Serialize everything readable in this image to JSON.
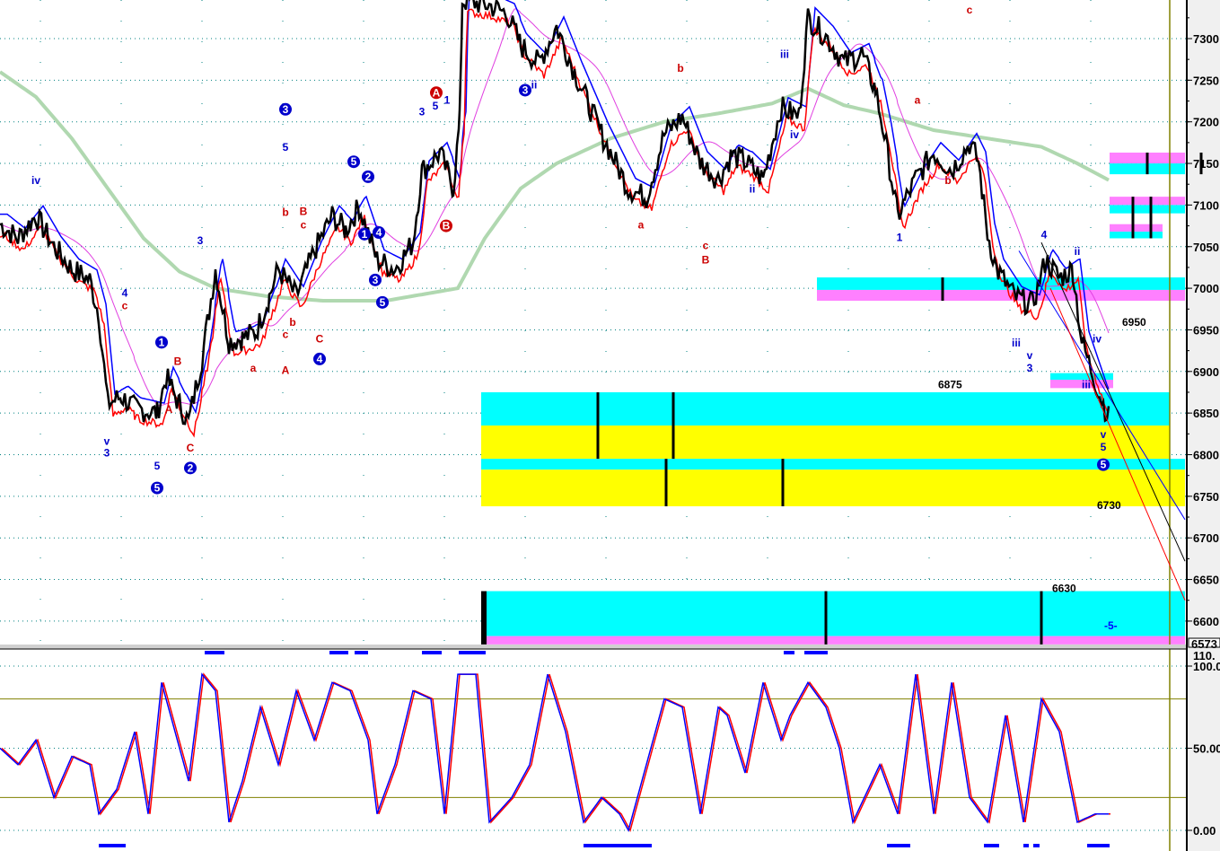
{
  "chart_data": {
    "type": "line",
    "title": "",
    "price_axis": {
      "ticks": [
        7300,
        7250,
        7200,
        7150,
        7100,
        7050,
        7000,
        6950,
        6900,
        6850,
        6800,
        6750,
        6700,
        6650,
        6600
      ],
      "range": [
        6573,
        7345
      ],
      "last_value_label": "6573"
    },
    "osc_axis": {
      "ticks": [
        "100.0",
        "50.00",
        "0.00"
      ],
      "tick_values": [
        100,
        50,
        0
      ],
      "top_label": "110.",
      "range": [
        -5,
        110
      ],
      "levels": [
        80,
        20
      ]
    },
    "x_range": [
      0,
      1300
    ],
    "price_series": [
      [
        0,
        7077
      ],
      [
        20,
        7060
      ],
      [
        40,
        7087
      ],
      [
        60,
        7050
      ],
      [
        80,
        7023
      ],
      [
        100,
        7010
      ],
      [
        110,
        6969
      ],
      [
        120,
        6861
      ],
      [
        135,
        6870
      ],
      [
        150,
        6856
      ],
      [
        175,
        6850
      ],
      [
        185,
        6893
      ],
      [
        200,
        6860
      ],
      [
        210,
        6839
      ],
      [
        225,
        6915
      ],
      [
        240,
        7023
      ],
      [
        255,
        6936
      ],
      [
        270,
        6940
      ],
      [
        285,
        6947
      ],
      [
        300,
        6990
      ],
      [
        310,
        7023
      ],
      [
        330,
        6990
      ],
      [
        350,
        7044
      ],
      [
        370,
        7087
      ],
      [
        385,
        7070
      ],
      [
        400,
        7098
      ],
      [
        420,
        7034
      ],
      [
        440,
        7023
      ],
      [
        460,
        7055
      ],
      [
        470,
        7141
      ],
      [
        490,
        7163
      ],
      [
        505,
        7120
      ],
      [
        512,
        7200
      ],
      [
        515,
        7346
      ],
      [
        545,
        7340
      ],
      [
        565,
        7330
      ],
      [
        580,
        7292
      ],
      [
        600,
        7270
      ],
      [
        620,
        7314
      ],
      [
        640,
        7260
      ],
      [
        670,
        7185
      ],
      [
        700,
        7120
      ],
      [
        720,
        7109
      ],
      [
        740,
        7185
      ],
      [
        760,
        7206
      ],
      [
        780,
        7152
      ],
      [
        800,
        7131
      ],
      [
        815,
        7160
      ],
      [
        830,
        7152
      ],
      [
        850,
        7131
      ],
      [
        870,
        7217
      ],
      [
        890,
        7206
      ],
      [
        900,
        7325
      ],
      [
        920,
        7303
      ],
      [
        940,
        7271
      ],
      [
        960,
        7282
      ],
      [
        975,
        7239
      ],
      [
        985,
        7185
      ],
      [
        1000,
        7087
      ],
      [
        1020,
        7131
      ],
      [
        1040,
        7163
      ],
      [
        1060,
        7142
      ],
      [
        1080,
        7174
      ],
      [
        1090,
        7152
      ],
      [
        1100,
        7066
      ],
      [
        1110,
        7023
      ],
      [
        1130,
        6990
      ],
      [
        1150,
        6980
      ],
      [
        1165,
        7034
      ],
      [
        1180,
        7012
      ],
      [
        1195,
        7023
      ],
      [
        1205,
        6936
      ],
      [
        1215,
        6904
      ],
      [
        1225,
        6872
      ],
      [
        1235,
        6845
      ]
    ],
    "moving_average": [
      [
        0,
        7260
      ],
      [
        40,
        7230
      ],
      [
        80,
        7180
      ],
      [
        120,
        7120
      ],
      [
        160,
        7060
      ],
      [
        200,
        7020
      ],
      [
        240,
        7000
      ],
      [
        300,
        6990
      ],
      [
        360,
        6985
      ],
      [
        430,
        6985
      ],
      [
        510,
        7000
      ],
      [
        540,
        7060
      ],
      [
        580,
        7120
      ],
      [
        620,
        7150
      ],
      [
        680,
        7180
      ],
      [
        740,
        7200
      ],
      [
        800,
        7210
      ],
      [
        860,
        7222
      ],
      [
        900,
        7240
      ],
      [
        940,
        7220
      ],
      [
        980,
        7210
      ],
      [
        1040,
        7190
      ],
      [
        1100,
        7180
      ],
      [
        1160,
        7170
      ],
      [
        1200,
        7150
      ],
      [
        1235,
        7130
      ]
    ],
    "oscillator": [
      [
        0,
        50
      ],
      [
        20,
        40
      ],
      [
        40,
        55
      ],
      [
        60,
        20
      ],
      [
        80,
        45
      ],
      [
        100,
        40
      ],
      [
        110,
        10
      ],
      [
        130,
        25
      ],
      [
        150,
        60
      ],
      [
        165,
        10
      ],
      [
        180,
        90
      ],
      [
        195,
        60
      ],
      [
        210,
        30
      ],
      [
        225,
        95
      ],
      [
        240,
        85
      ],
      [
        255,
        5
      ],
      [
        270,
        30
      ],
      [
        290,
        75
      ],
      [
        310,
        40
      ],
      [
        330,
        85
      ],
      [
        350,
        55
      ],
      [
        370,
        90
      ],
      [
        390,
        85
      ],
      [
        410,
        55
      ],
      [
        420,
        10
      ],
      [
        440,
        40
      ],
      [
        460,
        85
      ],
      [
        480,
        80
      ],
      [
        495,
        10
      ],
      [
        510,
        95
      ],
      [
        530,
        95
      ],
      [
        545,
        5
      ],
      [
        570,
        20
      ],
      [
        590,
        40
      ],
      [
        610,
        95
      ],
      [
        630,
        60
      ],
      [
        650,
        5
      ],
      [
        670,
        20
      ],
      [
        690,
        10
      ],
      [
        700,
        0
      ],
      [
        720,
        40
      ],
      [
        740,
        80
      ],
      [
        760,
        75
      ],
      [
        780,
        10
      ],
      [
        800,
        75
      ],
      [
        810,
        70
      ],
      [
        830,
        35
      ],
      [
        850,
        90
      ],
      [
        870,
        55
      ],
      [
        880,
        70
      ],
      [
        900,
        90
      ],
      [
        920,
        75
      ],
      [
        935,
        50
      ],
      [
        950,
        5
      ],
      [
        980,
        40
      ],
      [
        1000,
        10
      ],
      [
        1020,
        95
      ],
      [
        1040,
        10
      ],
      [
        1060,
        90
      ],
      [
        1080,
        20
      ],
      [
        1100,
        5
      ],
      [
        1120,
        70
      ],
      [
        1140,
        5
      ],
      [
        1160,
        80
      ],
      [
        1180,
        60
      ],
      [
        1200,
        5
      ],
      [
        1220,
        10
      ],
      [
        1235,
        10
      ]
    ],
    "zones": [
      {
        "x0": 536,
        "x1": 1303,
        "p0": 6875,
        "p1": 6835,
        "color": "#00ffff"
      },
      {
        "x0": 536,
        "x1": 1303,
        "p0": 6835,
        "p1": 6795,
        "color": "#ffff00"
      },
      {
        "x0": 536,
        "x1": 1320,
        "p0": 6795,
        "p1": 6782,
        "color": "#00ffff"
      },
      {
        "x0": 536,
        "x1": 1320,
        "p0": 6782,
        "p1": 6738,
        "color": "#ffff00"
      },
      {
        "x0": 536,
        "x1": 1320,
        "p0": 6636,
        "p1": 6582,
        "color": "#00ffff"
      },
      {
        "x0": 536,
        "x1": 1320,
        "p0": 6582,
        "p1": 6572,
        "color": "#ff80ff"
      },
      {
        "x0": 910,
        "x1": 1320,
        "p0": 7013,
        "p1": 6998,
        "color": "#00ffff"
      },
      {
        "x0": 910,
        "x1": 1320,
        "p0": 6998,
        "p1": 6985,
        "color": "#ff80ff"
      },
      {
        "x0": 1236,
        "x1": 1320,
        "p0": 7163,
        "p1": 7150,
        "color": "#ff80ff"
      },
      {
        "x0": 1236,
        "x1": 1320,
        "p0": 7150,
        "p1": 7137,
        "color": "#00ffff"
      },
      {
        "x0": 1236,
        "x1": 1320,
        "p0": 7110,
        "p1": 7100,
        "color": "#ff80ff"
      },
      {
        "x0": 1236,
        "x1": 1320,
        "p0": 7100,
        "p1": 7090,
        "color": "#00ffff"
      },
      {
        "x0": 1236,
        "x1": 1295,
        "p0": 7077,
        "p1": 7068,
        "color": "#ff80ff"
      },
      {
        "x0": 1236,
        "x1": 1295,
        "p0": 7068,
        "p1": 7060,
        "color": "#00ffff"
      },
      {
        "x0": 1170,
        "x1": 1240,
        "p0": 6898,
        "p1": 6890,
        "color": "#00ffff"
      },
      {
        "x0": 1170,
        "x1": 1240,
        "p0": 6890,
        "p1": 6880,
        "color": "#ff80ff"
      }
    ],
    "price_labels": [
      {
        "text": "6950",
        "x": 1250,
        "p": 6955
      },
      {
        "text": "6875",
        "x": 1045,
        "p": 6880
      },
      {
        "text": "6730",
        "x": 1222,
        "p": 6735
      },
      {
        "text": "6630",
        "x": 1172,
        "p": 6635
      },
      {
        "text": "-5-",
        "x": 1230,
        "p": 6590,
        "color": "#0000ff"
      }
    ],
    "wave_labels": [
      {
        "t": "iv",
        "x": 40,
        "p": 7125,
        "c": "#0000cc"
      },
      {
        "t": "4",
        "x": 139,
        "p": 6990,
        "c": "#0000cc"
      },
      {
        "t": "c",
        "x": 139,
        "p": 6975,
        "c": "#cc0000"
      },
      {
        "t": "v",
        "x": 119,
        "p": 6812,
        "c": "#0000cc"
      },
      {
        "t": "3",
        "x": 119,
        "p": 6798,
        "c": "#0000cc"
      },
      {
        "t": "5",
        "x": 175,
        "p": 6782,
        "c": "#0000cc"
      },
      {
        "t": "5",
        "x": 175,
        "p": 6760,
        "c": "#0000cc",
        "circle": true
      },
      {
        "t": "1",
        "x": 180,
        "p": 6935,
        "c": "#0000cc",
        "circle": true
      },
      {
        "t": "B",
        "x": 198,
        "p": 6908,
        "c": "#cc0000"
      },
      {
        "t": "A",
        "x": 188,
        "p": 6850,
        "c": "#cc0000"
      },
      {
        "t": "C",
        "x": 212,
        "p": 6804,
        "c": "#cc0000"
      },
      {
        "t": "2",
        "x": 212,
        "p": 6784,
        "c": "#0000cc",
        "circle": true
      },
      {
        "t": "3",
        "x": 223,
        "p": 7053,
        "c": "#0000cc"
      },
      {
        "t": "a",
        "x": 282,
        "p": 6900,
        "c": "#cc0000"
      },
      {
        "t": "A",
        "x": 318,
        "p": 6897,
        "c": "#cc0000"
      },
      {
        "t": "c",
        "x": 318,
        "p": 6940,
        "c": "#cc0000"
      },
      {
        "t": "b",
        "x": 326,
        "p": 6955,
        "c": "#cc0000"
      },
      {
        "t": "C",
        "x": 356,
        "p": 6935,
        "c": "#cc0000"
      },
      {
        "t": "4",
        "x": 356,
        "p": 6915,
        "c": "#0000cc",
        "circle": true
      },
      {
        "t": "3",
        "x": 318,
        "p": 7215,
        "c": "#0000cc",
        "circle": true
      },
      {
        "t": "5",
        "x": 318,
        "p": 7165,
        "c": "#0000cc"
      },
      {
        "t": "b",
        "x": 318,
        "p": 7087,
        "c": "#cc0000"
      },
      {
        "t": "B",
        "x": 338,
        "p": 7088,
        "c": "#cc0000"
      },
      {
        "t": "c",
        "x": 338,
        "p": 7072,
        "c": "#cc0000"
      },
      {
        "t": "5",
        "x": 394,
        "p": 7152,
        "c": "#0000cc",
        "circle": true
      },
      {
        "t": "2",
        "x": 410,
        "p": 7134,
        "c": "#0000cc",
        "circle": true
      },
      {
        "t": "1",
        "x": 406,
        "p": 7065,
        "c": "#0000cc",
        "circle": true
      },
      {
        "t": "4",
        "x": 422,
        "p": 7067,
        "c": "#0000cc",
        "circle": true
      },
      {
        "t": "3",
        "x": 418,
        "p": 7010,
        "c": "#0000cc",
        "circle": true
      },
      {
        "t": "5",
        "x": 426,
        "p": 6983,
        "c": "#0000cc",
        "circle": true
      },
      {
        "t": "A",
        "x": 486,
        "p": 7235,
        "c": "#cc0000",
        "circle": true
      },
      {
        "t": "B",
        "x": 497,
        "p": 7075,
        "c": "#cc0000",
        "circle": true
      },
      {
        "t": "5",
        "x": 485,
        "p": 7215,
        "c": "#0000cc"
      },
      {
        "t": "3",
        "x": 470,
        "p": 7208,
        "c": "#0000cc"
      },
      {
        "t": "1",
        "x": 498,
        "p": 7222,
        "c": "#0000cc"
      },
      {
        "t": "3",
        "x": 585,
        "p": 7238,
        "c": "#0000cc",
        "circle": true
      },
      {
        "t": "ii",
        "x": 595,
        "p": 7240,
        "c": "#0000cc"
      },
      {
        "t": "a",
        "x": 714,
        "p": 7072,
        "c": "#cc0000"
      },
      {
        "t": "b",
        "x": 758,
        "p": 7260,
        "c": "#cc0000"
      },
      {
        "t": "c",
        "x": 786,
        "p": 7047,
        "c": "#cc0000"
      },
      {
        "t": "B",
        "x": 786,
        "p": 7030,
        "c": "#cc0000"
      },
      {
        "t": "ii",
        "x": 838,
        "p": 7115,
        "c": "#0000cc"
      },
      {
        "t": "iii",
        "x": 874,
        "p": 7277,
        "c": "#0000cc"
      },
      {
        "t": "iv",
        "x": 885,
        "p": 7180,
        "c": "#0000cc"
      },
      {
        "t": "c",
        "x": 1080,
        "p": 7330,
        "c": "#cc0000"
      },
      {
        "t": "a",
        "x": 1022,
        "p": 7222,
        "c": "#cc0000"
      },
      {
        "t": "b",
        "x": 1056,
        "p": 7125,
        "c": "#cc0000"
      },
      {
        "t": "1",
        "x": 1002,
        "p": 7057,
        "c": "#0000cc"
      },
      {
        "t": "4",
        "x": 1163,
        "p": 7060,
        "c": "#0000cc"
      },
      {
        "t": "ii",
        "x": 1200,
        "p": 7040,
        "c": "#0000cc"
      },
      {
        "t": "iii",
        "x": 1132,
        "p": 6930,
        "c": "#0000cc"
      },
      {
        "t": "v",
        "x": 1147,
        "p": 6915,
        "c": "#0000cc"
      },
      {
        "t": "3",
        "x": 1147,
        "p": 6900,
        "c": "#0000cc"
      },
      {
        "t": "iv",
        "x": 1222,
        "p": 6935,
        "c": "#0000cc"
      },
      {
        "t": "iii",
        "x": 1210,
        "p": 6880,
        "c": "#0000cc"
      },
      {
        "t": "v",
        "x": 1229,
        "p": 6820,
        "c": "#0000cc"
      },
      {
        "t": "5",
        "x": 1229,
        "p": 6805,
        "c": "#0000cc"
      },
      {
        "t": "5",
        "x": 1229,
        "p": 6788,
        "c": "#0000cc",
        "circle": true
      }
    ],
    "trend_lines": [
      {
        "from": [
          1135,
          7045
        ],
        "to": [
          1320,
          6722
        ],
        "color": "#0000ff"
      },
      {
        "from": [
          1160,
          7055
        ],
        "to": [
          1320,
          6672
        ],
        "color": "#000000"
      },
      {
        "from": [
          1170,
          7000
        ],
        "to": [
          1320,
          6625
        ],
        "color": "#ff0000"
      }
    ]
  }
}
